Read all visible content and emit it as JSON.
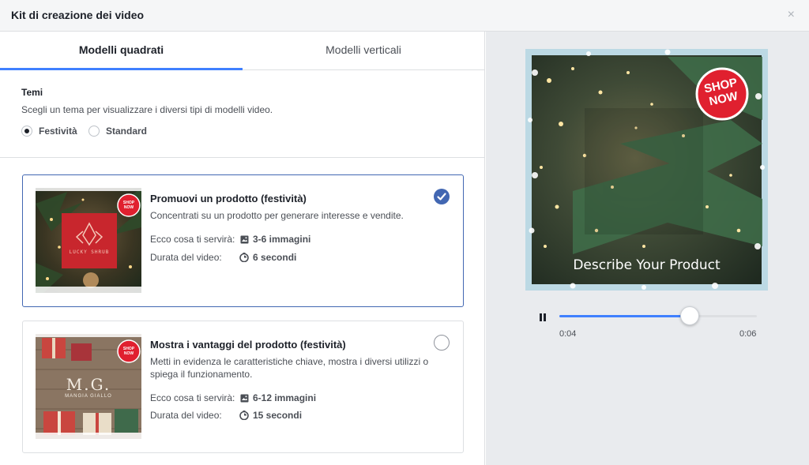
{
  "dialog": {
    "title": "Kit di creazione dei video",
    "close_glyph": "×"
  },
  "tabs": [
    {
      "label": "Modelli quadrati",
      "active": true
    },
    {
      "label": "Modelli verticali",
      "active": false
    }
  ],
  "themes": {
    "label": "Temi",
    "description": "Scegli un tema per visualizzare i diversi tipi di modelli video.",
    "options": [
      {
        "label": "Festività",
        "selected": true
      },
      {
        "label": "Standard",
        "selected": false
      }
    ]
  },
  "templates": [
    {
      "title": "Promuovi un prodotto (festività)",
      "description": "Concentrati su un prodotto per generare interesse e vendite.",
      "needs_label": "Ecco cosa ti servirà:",
      "needs_value": "3-6 immagini",
      "duration_label": "Durata del video:",
      "duration_value": "6 secondi",
      "selected": true,
      "thumb_badge": "SHOP NOW",
      "thumb_logo_text": "LUCKY SHRUB"
    },
    {
      "title": "Mostra i vantaggi del prodotto (festività)",
      "description": "Metti in evidenza le caratteristiche chiave, mostra i diversi utilizzi o spiega il funzionamento.",
      "needs_label": "Ecco cosa ti servirà:",
      "needs_value": "6-12 immagini",
      "duration_label": "Durata del video:",
      "duration_value": "15 secondi",
      "selected": false,
      "thumb_badge": "SHOP NOW",
      "thumb_logo_text": "M.G.",
      "thumb_logo_subtext": "MANGIA GIALLO"
    }
  ],
  "preview": {
    "badge_line1": "SHOP",
    "badge_line2": "NOW",
    "caption": "Describe Your Product",
    "current_time": "0:04",
    "total_time": "0:06",
    "progress": 0.66
  },
  "colors": {
    "accent": "#4080ff",
    "selected_border": "#4267b2",
    "badge_red": "#e0202f"
  },
  "icons": {
    "close": "close-icon",
    "images": "image-icon",
    "duration": "timer-icon",
    "pause": "pause-icon",
    "check": "checkmark-icon"
  }
}
